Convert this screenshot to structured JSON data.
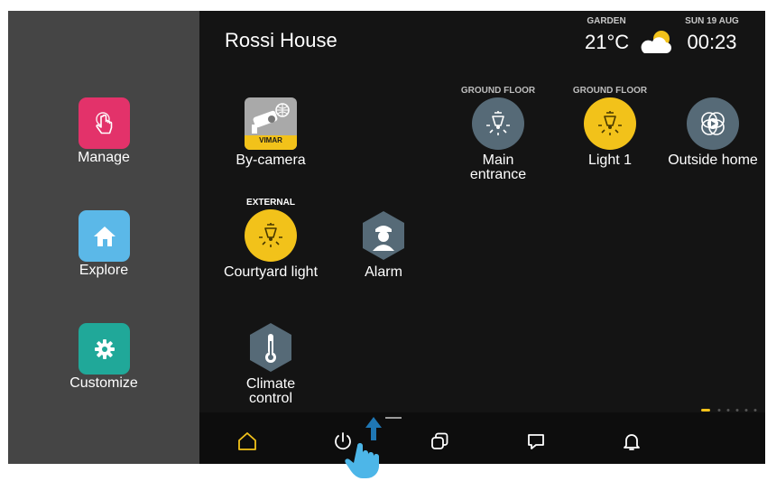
{
  "sidebar": {
    "items": [
      {
        "label": "Manage",
        "icon": "touch-hand-icon",
        "color": "#e3326a"
      },
      {
        "label": "Explore",
        "icon": "home-icon",
        "color": "#5bb8e8"
      },
      {
        "label": "Customize",
        "icon": "gear-icon",
        "color": "#20a899"
      }
    ]
  },
  "header": {
    "house_name": "Rossi House",
    "weather": {
      "location": "GARDEN",
      "temperature": "21°C",
      "icon": "partly-cloudy-icon"
    },
    "date": "SUN 19 AUG",
    "time": "00:23"
  },
  "tiles": {
    "by_camera": {
      "label": "By-camera",
      "brand": "VIMAR"
    },
    "main_entrance": {
      "caption": "GROUND FLOOR",
      "label_line1": "Main",
      "label_line2": "entrance",
      "state": "off"
    },
    "light_1": {
      "caption": "GROUND FLOOR",
      "label": "Light 1",
      "state": "on"
    },
    "outside_home": {
      "label": "Outside home"
    },
    "courtyard_light": {
      "caption": "EXTERNAL",
      "label": "Courtyard light",
      "state": "on"
    },
    "alarm": {
      "label": "Alarm"
    },
    "climate_control": {
      "label_line1": "Climate",
      "label_line2": "control"
    }
  },
  "bottom_nav": {
    "items": [
      "home-icon",
      "power-icon",
      "copy-icon",
      "chat-icon",
      "bell-icon"
    ],
    "active": "home-icon"
  },
  "colors": {
    "accent": "#f2c21a",
    "light_on": "#f2c21a",
    "light_off": "#566a77",
    "sidebar_bg": "#454545",
    "main_bg": "#141414"
  }
}
